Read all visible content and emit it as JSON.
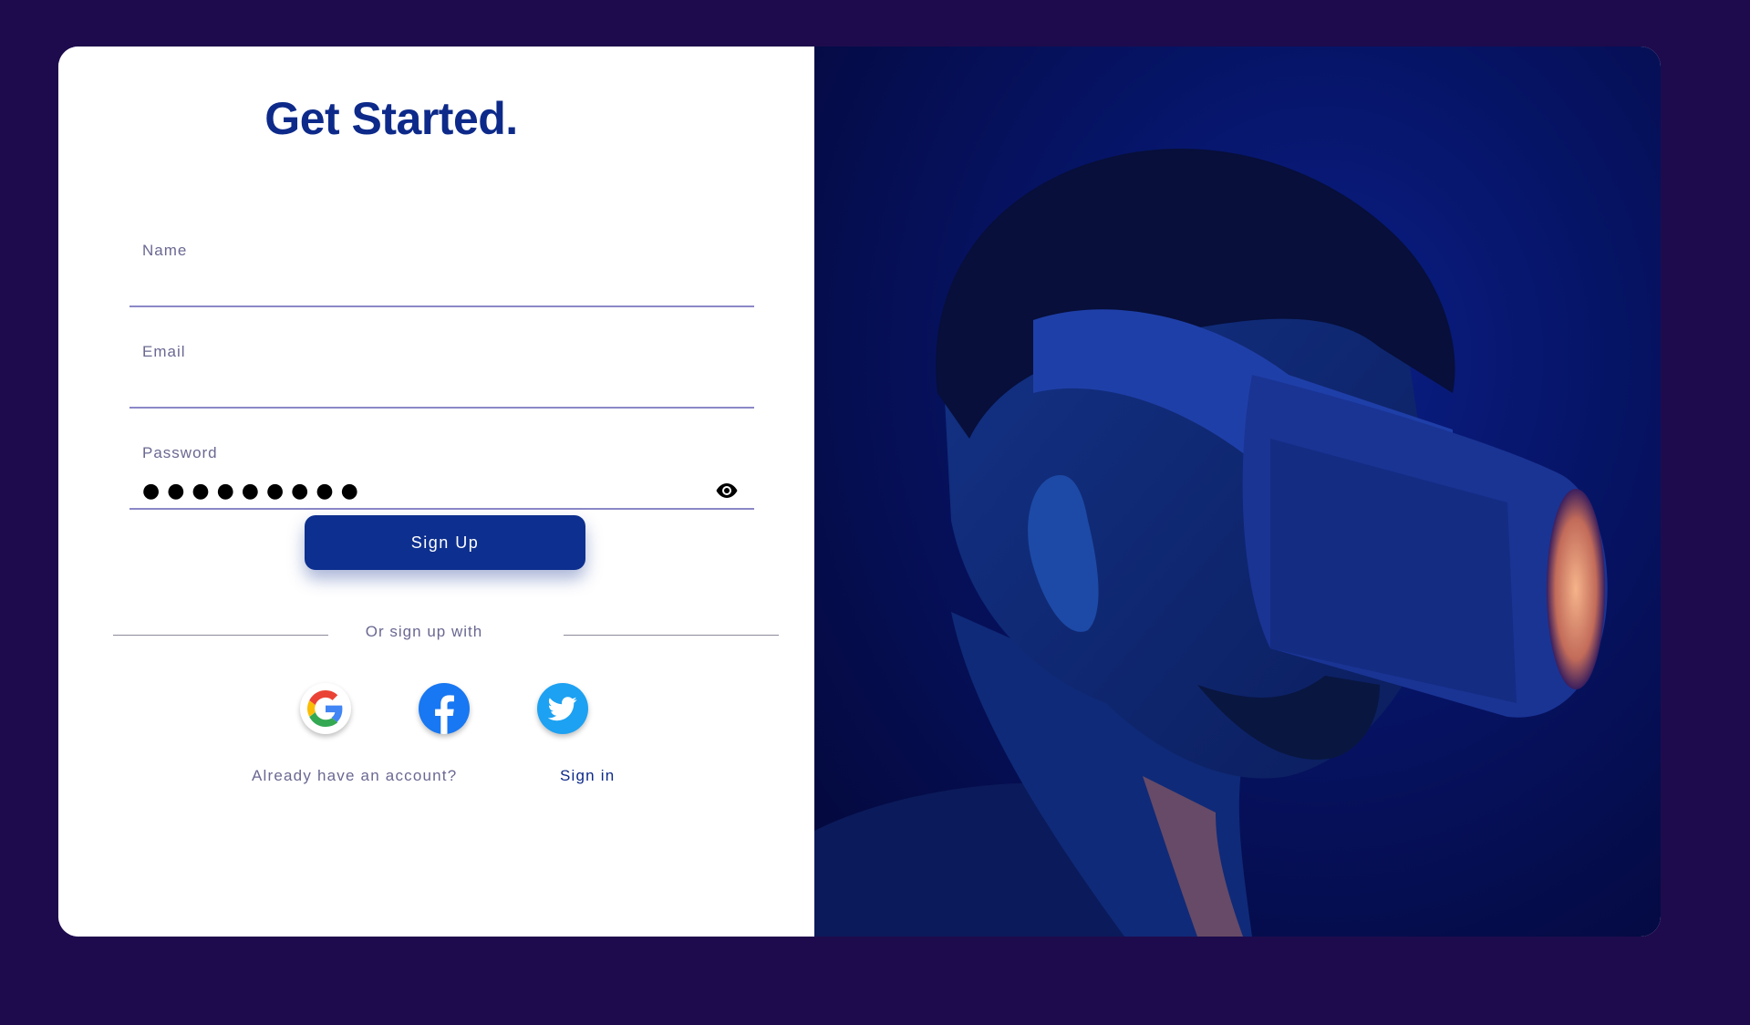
{
  "form": {
    "title": "Get Started.",
    "fields": {
      "name": {
        "label": "Name",
        "value": ""
      },
      "email": {
        "label": "Email",
        "value": ""
      },
      "password": {
        "label": "Password",
        "value": "●●●●●●●●●"
      }
    },
    "submit_label": "Sign Up",
    "divider_text": "Or sign up with",
    "social": [
      {
        "icon": "google-icon"
      },
      {
        "icon": "facebook-icon"
      },
      {
        "icon": "twitter-icon"
      }
    ],
    "account_prompt": "Already have an account?",
    "signin_label": "Sign in"
  },
  "colors": {
    "background": "#1e0b4d",
    "brand": "#0d2f8f",
    "input_underline": "#8b88c8",
    "muted_text": "#6a6892"
  }
}
